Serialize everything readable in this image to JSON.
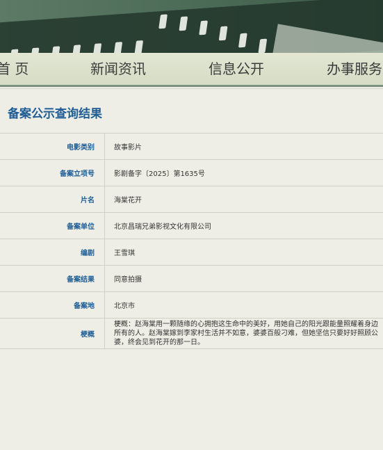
{
  "nav": {
    "items": [
      {
        "label": "首 页"
      },
      {
        "label": "新闻资讯"
      },
      {
        "label": "信息公开"
      },
      {
        "label": "办事服务"
      }
    ]
  },
  "page_title": "备案公示查询结果",
  "rows": [
    {
      "label": "电影类别",
      "value": "故事影片"
    },
    {
      "label": "备案立项号",
      "value": "影剧备字〔2025〕第1635号"
    },
    {
      "label": "片名",
      "value": "海棠花开"
    },
    {
      "label": "备案单位",
      "value": "北京昌瑞兄弟影视文化有限公司"
    },
    {
      "label": "编剧",
      "value": "王雪琪"
    },
    {
      "label": "备案结果",
      "value": "同意拍摄"
    },
    {
      "label": "备案地",
      "value": "北京市"
    },
    {
      "label": "梗概",
      "value": "梗概：赵海棠用一颗随缘的心拥抱这生命中的美好，用她自己的阳光跟能量照耀着身边所有的人。赵海棠嫁到李家村生活并不如意，婆婆百般刁难，但她坚信只要好好照顾公婆，终会见到花开的那一日。"
    }
  ],
  "colors": {
    "banner": "#4b6a56",
    "nav_bg": "#dde2cd",
    "label_text": "#1f5d94",
    "page_bg": "#eeeee6"
  }
}
